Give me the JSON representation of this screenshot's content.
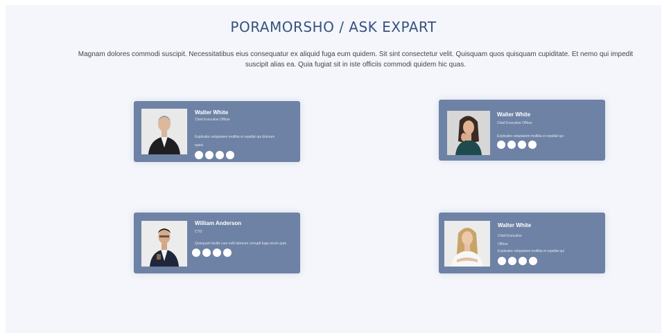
{
  "section": {
    "title": "PORAMORSHO / ASK EXPART",
    "description": "Magnam dolores commodi suscipit. Necessitatibus eius consequatur ex aliquid fuga eum quidem. Sit sint consectetur velit. Quisquam quos quisquam cupiditate. Et nemo qui impedit suscipit alias ea. Quia fugiat sit in iste officiis commodi quidem hic quas."
  },
  "members": [
    {
      "name": "Walter White",
      "role": "Chief Executive Officer",
      "description": "Explicabo voluptatem mollitia et repellat qui dolorum quasi",
      "socials": [
        "twitter-icon",
        "facebook-icon",
        "instagram-icon",
        "linkedin-icon"
      ]
    },
    {
      "name": "Walter White",
      "role": "Chief Executive Officer",
      "description": "Explicabo voluptatem mollitia et repellat qui",
      "socials": [
        "twitter-icon",
        "facebook-icon",
        "instagram-icon",
        "linkedin-icon"
      ]
    },
    {
      "name": "William Anderson",
      "role": "CTO",
      "description": "Quisquam facilis cum velit laborum corrupti fuga rerum quia",
      "socials": [
        "twitter-icon",
        "facebook-icon",
        "instagram-icon",
        "linkedin-icon"
      ]
    },
    {
      "name": "Walter White",
      "role": "Chief Executive Officer",
      "description": "Explicabo voluptatem mollitia et repellat qui",
      "socials": [
        "twitter-icon",
        "facebook-icon",
        "instagram-icon",
        "linkedin-icon"
      ]
    }
  ],
  "colors": {
    "accent": "#37517e",
    "card": "#6e82a5",
    "background": "#f4f6fb"
  }
}
